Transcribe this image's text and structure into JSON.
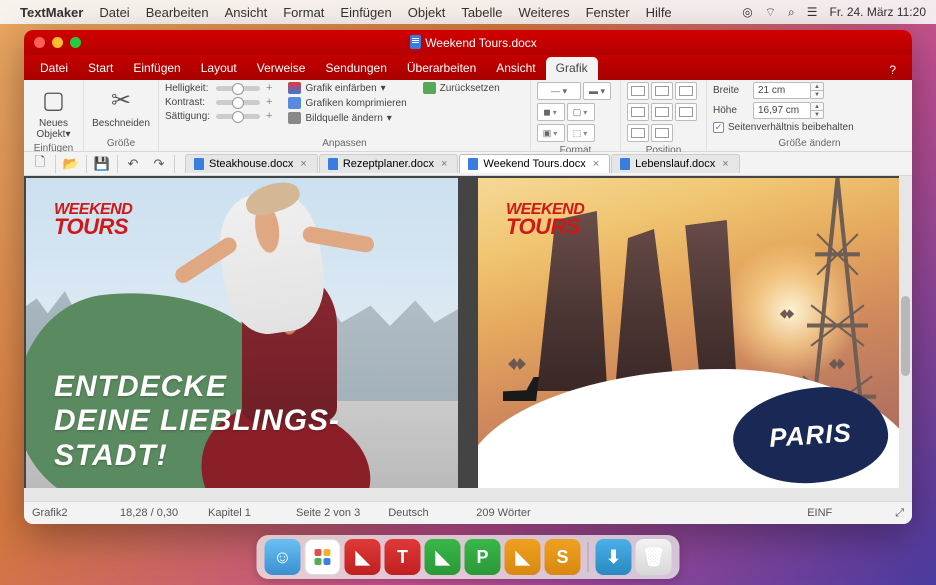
{
  "macbar": {
    "app": "TextMaker",
    "menus": [
      "Datei",
      "Bearbeiten",
      "Ansicht",
      "Format",
      "Einfügen",
      "Objekt",
      "Tabelle",
      "Weiteres",
      "Fenster",
      "Hilfe"
    ],
    "clock": "Fr. 24. März  11:20"
  },
  "window": {
    "title": "Weekend Tours.docx"
  },
  "menubar": {
    "tabs": [
      "Datei",
      "Start",
      "Einfügen",
      "Layout",
      "Verweise",
      "Sendungen",
      "Überarbeiten",
      "Ansicht",
      "Grafik"
    ],
    "active": "Grafik",
    "help": "?"
  },
  "ribbon": {
    "insert": {
      "new_object": "Neues\nObjekt",
      "label": "Einfügen"
    },
    "size_grp": {
      "crop": "Beschneiden",
      "label": "Größe"
    },
    "adjust": {
      "brightness": "Helligkeit:",
      "contrast": "Kontrast:",
      "saturation": "Sättigung:",
      "recolor": "Grafik einfärben",
      "compress": "Grafiken komprimieren",
      "change_src": "Bildquelle ändern",
      "reset": "Zurücksetzen",
      "label": "Anpassen"
    },
    "format": {
      "label": "Format"
    },
    "position": {
      "label": "Position"
    },
    "resize": {
      "width": "Breite",
      "height": "Höhe",
      "w_val": "21 cm",
      "h_val": "16,97 cm",
      "aspect": "Seitenverhältnis beibehalten",
      "label": "Größe ändern"
    }
  },
  "doctabs": [
    {
      "name": "Steakhouse.docx",
      "active": false
    },
    {
      "name": "Rezeptplaner.docx",
      "active": false
    },
    {
      "name": "Weekend Tours.docx",
      "active": true
    },
    {
      "name": "Lebenslauf.docx",
      "active": false
    }
  ],
  "page1": {
    "logo1": "WEEKEND",
    "logo2": "TOURS",
    "headline1": "ENTDECKE",
    "headline2": "DEINE LIEBLINGS-",
    "headline3": "STADT!"
  },
  "page2": {
    "logo1": "WEEKEND",
    "logo2": "TOURS",
    "city": "PARIS"
  },
  "status": {
    "object": "Grafik2",
    "pos": "18,28 / 0,30",
    "chapter": "Kapitel 1",
    "page": "Seite 2 von 3",
    "lang": "Deutsch",
    "words": "209 Wörter",
    "mode": "EINF"
  }
}
